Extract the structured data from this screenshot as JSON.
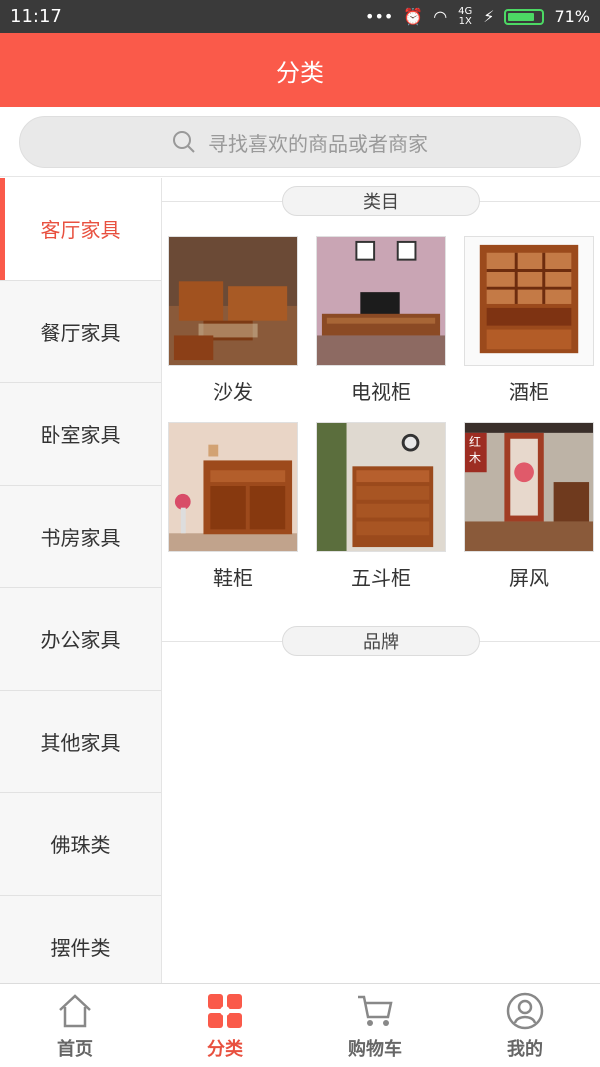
{
  "status_bar": {
    "time": "11:17",
    "network": "4G 1X",
    "battery": "71%"
  },
  "header": {
    "title": "分类"
  },
  "search": {
    "placeholder": "寻找喜欢的商品或者商家"
  },
  "sidebar": {
    "items": [
      {
        "label": "客厅家具",
        "active": true
      },
      {
        "label": "餐厅家具"
      },
      {
        "label": "卧室家具"
      },
      {
        "label": "书房家具"
      },
      {
        "label": "办公家具"
      },
      {
        "label": "其他家具"
      },
      {
        "label": "佛珠类"
      },
      {
        "label": "摆件类"
      }
    ]
  },
  "content": {
    "category_title": "类目",
    "products": [
      {
        "label": "沙发",
        "icon": "sofa-image"
      },
      {
        "label": "电视柜",
        "icon": "tv-cabinet-image"
      },
      {
        "label": "酒柜",
        "icon": "wine-cabinet-image"
      },
      {
        "label": "鞋柜",
        "icon": "shoe-cabinet-image"
      },
      {
        "label": "五斗柜",
        "icon": "chest-of-drawers-image"
      },
      {
        "label": "屏风",
        "icon": "screen-image",
        "overlay_text": [
          "红",
          "木"
        ]
      }
    ],
    "brand_title": "品牌"
  },
  "tabbar": {
    "items": [
      {
        "label": "首页",
        "icon": "home-icon"
      },
      {
        "label": "分类",
        "icon": "category-icon",
        "active": true
      },
      {
        "label": "购物车",
        "icon": "cart-icon"
      },
      {
        "label": "我的",
        "icon": "profile-icon"
      }
    ]
  },
  "colors": {
    "accent": "#fa5a4a",
    "active_text": "#e8503f",
    "statusbar": "#3a3a3a"
  }
}
